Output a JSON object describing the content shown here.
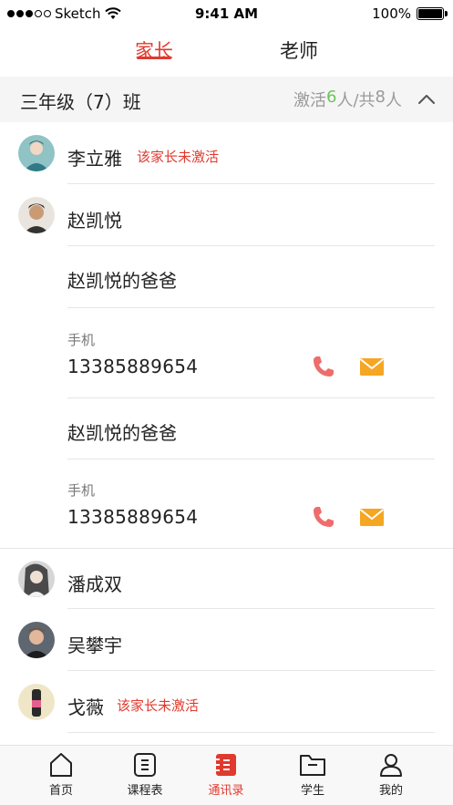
{
  "status_bar": {
    "carrier": "Sketch",
    "time": "9:41 AM",
    "battery": "100%"
  },
  "tabs": [
    {
      "label": "家长",
      "active": true
    },
    {
      "label": "老师",
      "active": false
    }
  ],
  "class_header": {
    "name": "三年级（7）班",
    "stats_prefix": "激活",
    "activated": "6",
    "stats_mid": "人/共",
    "total": "8",
    "stats_suffix": "人"
  },
  "parents": [
    {
      "name": "李立雅",
      "status": "该家长未激活"
    },
    {
      "name": "赵凯悦",
      "status": ""
    },
    {
      "name": "潘成双",
      "status": ""
    },
    {
      "name": "吴攀宇",
      "status": ""
    },
    {
      "name": "戈薇",
      "status": "该家长未激活"
    }
  ],
  "contacts": [
    {
      "relation": "赵凯悦的爸爸",
      "phone_label": "手机",
      "phone": "13385889654"
    },
    {
      "relation": "赵凯悦的爸爸",
      "phone_label": "手机",
      "phone": "13385889654"
    }
  ],
  "tabbar": [
    {
      "label": "首页",
      "icon": "home-icon",
      "active": false
    },
    {
      "label": "课程表",
      "icon": "schedule-icon",
      "active": false
    },
    {
      "label": "通讯录",
      "icon": "contacts-icon",
      "active": true
    },
    {
      "label": "学生",
      "icon": "folder-icon",
      "active": false
    },
    {
      "label": "我的",
      "icon": "person-icon",
      "active": false
    }
  ],
  "colors": {
    "accent": "#e03a2e",
    "activated_green": "#6dc35a",
    "call": "#ef6c6c",
    "message": "#f5a623"
  }
}
